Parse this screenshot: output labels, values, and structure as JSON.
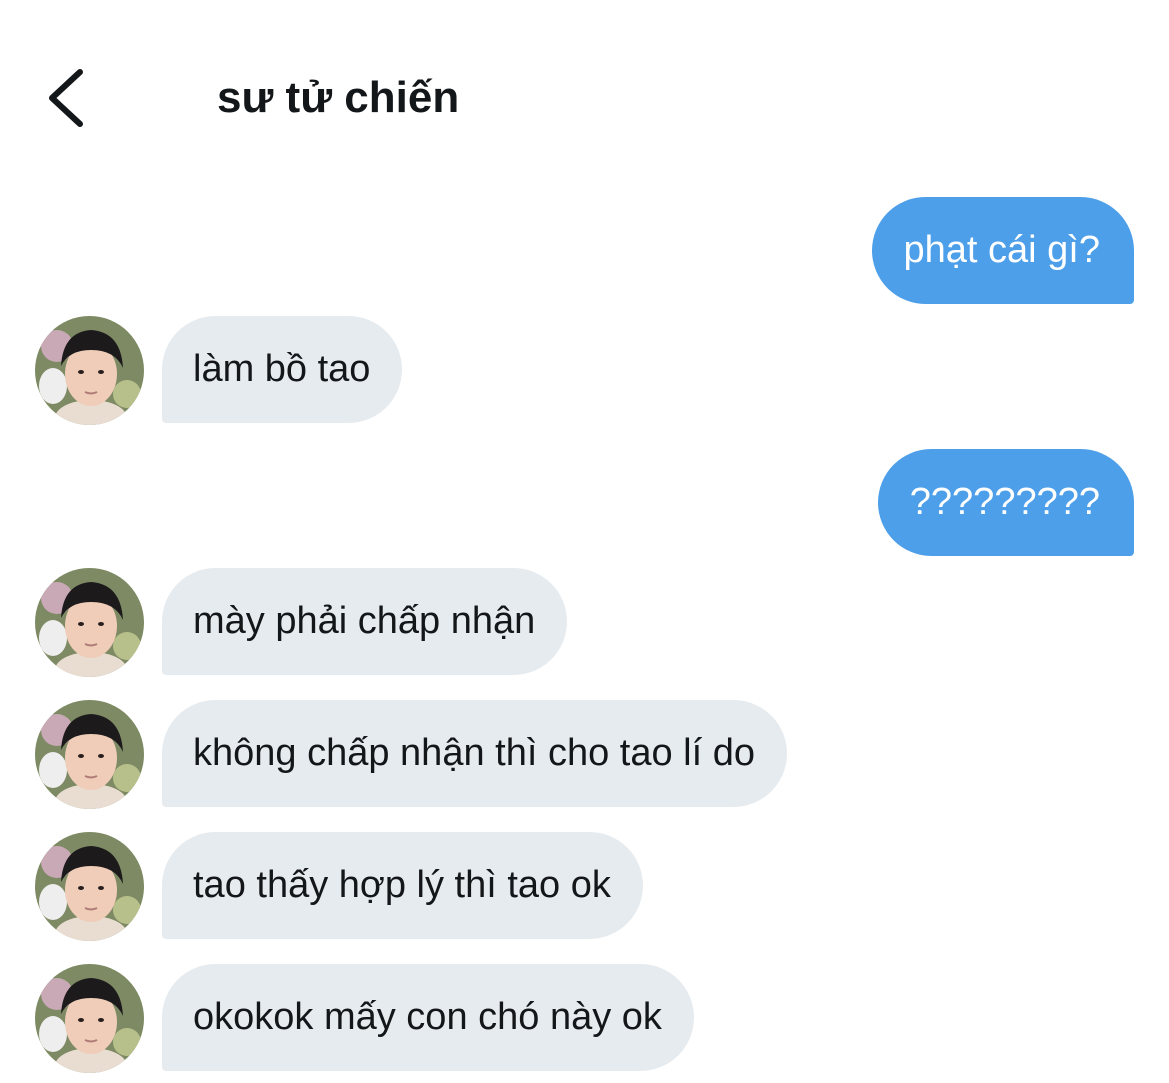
{
  "header": {
    "title": "sư tử chiến",
    "back_icon": "chevron-left-icon"
  },
  "messages": [
    {
      "direction": "out",
      "text": "phạt cái gì?"
    },
    {
      "direction": "in",
      "text": "làm bồ tao"
    },
    {
      "direction": "out",
      "text": "?????????"
    },
    {
      "direction": "in",
      "text": "mày phải chấp nhận"
    },
    {
      "direction": "in",
      "text": "không chấp nhận thì cho tao lí do"
    },
    {
      "direction": "in",
      "text": "tao thấy hợp lý thì tao ok"
    },
    {
      "direction": "in",
      "text": "okokok mấy con chó này ok"
    }
  ],
  "colors": {
    "outgoing_bubble": "#4d9fea",
    "incoming_bubble": "#e6ebef",
    "text": "#14171a"
  }
}
